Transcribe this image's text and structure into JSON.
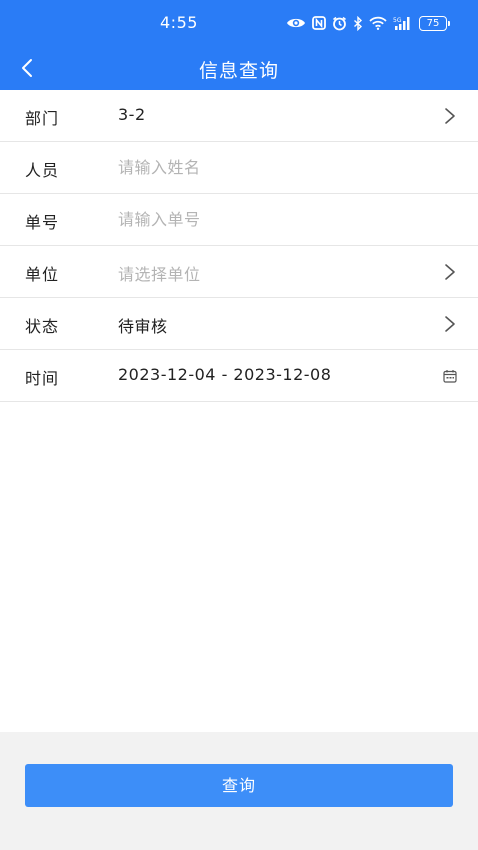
{
  "status_bar": {
    "time": "4:55",
    "battery": "75",
    "icons": [
      "eye-icon",
      "nfc-icon",
      "alarm-icon",
      "bluetooth-icon",
      "wifi-icon",
      "signal-5g-icon",
      "battery-icon"
    ]
  },
  "nav": {
    "title": "信息查询",
    "back_icon": "chevron-left-icon"
  },
  "form": {
    "department": {
      "label": "部门",
      "value": "3-2",
      "icon": "chevron-right-icon"
    },
    "person": {
      "label": "人员",
      "value": "",
      "placeholder": "请输入姓名"
    },
    "order_no": {
      "label": "单号",
      "value": "",
      "placeholder": "请输入单号"
    },
    "unit": {
      "label": "单位",
      "placeholder": "请选择单位",
      "icon": "chevron-right-icon"
    },
    "status": {
      "label": "状态",
      "value": "待审核",
      "icon": "chevron-right-icon"
    },
    "time": {
      "label": "时间",
      "value": "2023-12-04 - 2023-12-08",
      "icon": "calendar-icon"
    }
  },
  "actions": {
    "query_label": "查询"
  },
  "colors": {
    "brand": "#2a7cf6",
    "button": "#3d8ef8",
    "placeholder": "#b4b4b4",
    "bottom_bg": "#f2f2f2"
  }
}
